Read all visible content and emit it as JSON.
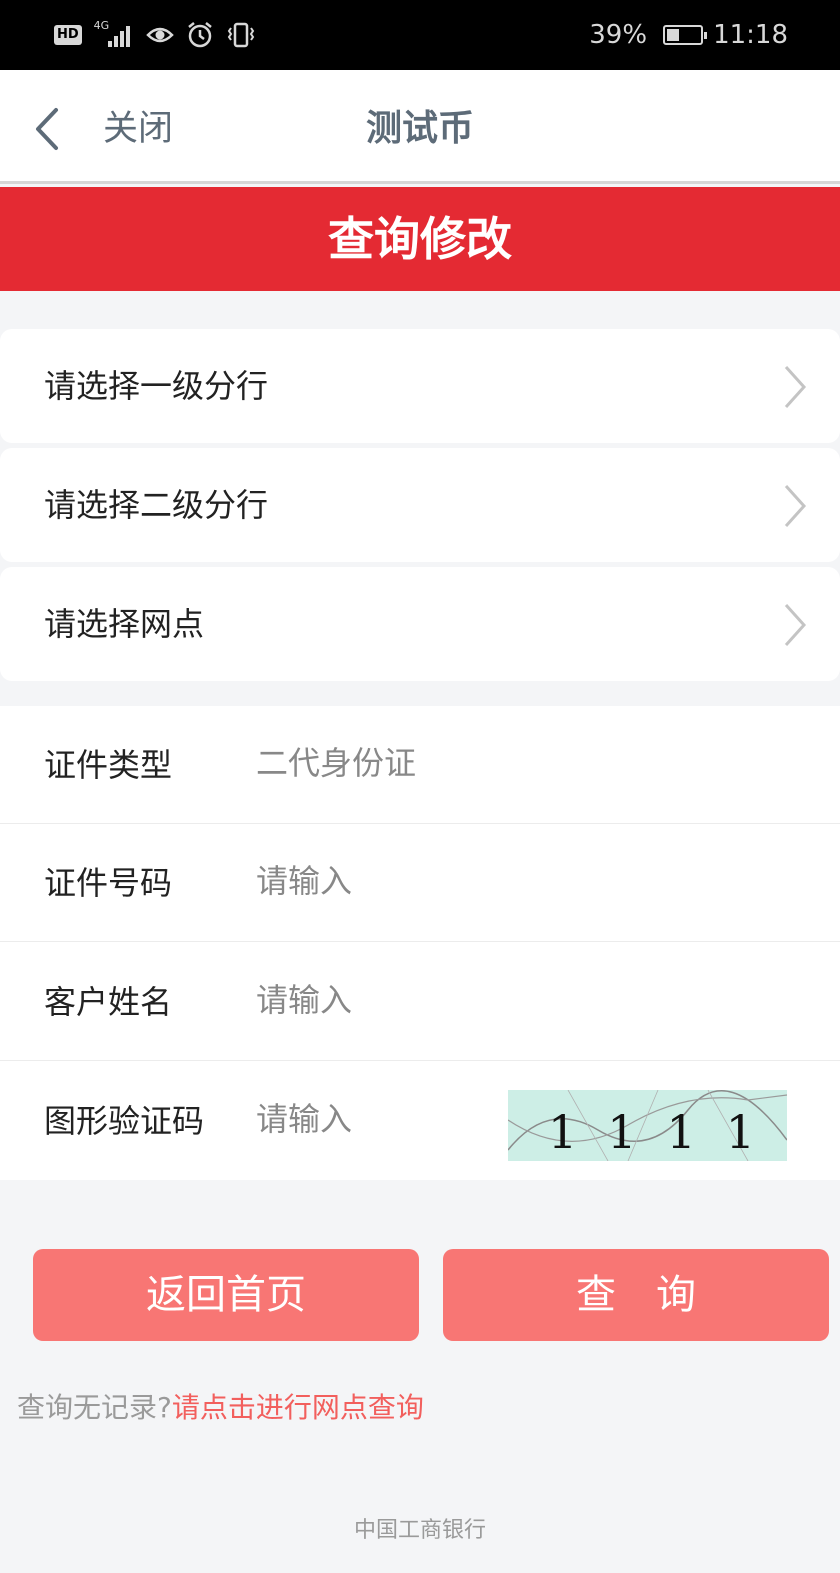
{
  "status_bar": {
    "hd_badge": "HD",
    "network": "4G",
    "icons": [
      "hd-icon",
      "signal-icon",
      "eye-icon",
      "alarm-icon",
      "vibrate-icon"
    ],
    "battery_percent": "39%",
    "battery_level": 0.39,
    "time": "11:18"
  },
  "nav": {
    "close_label": "关闭",
    "title": "测试币"
  },
  "page_header": "查询修改",
  "branch_selectors": [
    {
      "label": "请选择一级分行"
    },
    {
      "label": "请选择二级分行"
    },
    {
      "label": "请选择网点"
    }
  ],
  "form": {
    "id_type": {
      "label": "证件类型",
      "value": "二代身份证"
    },
    "id_number": {
      "label": "证件号码",
      "placeholder": "请输入"
    },
    "customer_name": {
      "label": "客户姓名",
      "placeholder": "请输入"
    },
    "captcha": {
      "label": "图形验证码",
      "placeholder": "请输入",
      "image_text": "1111"
    }
  },
  "buttons": {
    "home": "返回首页",
    "query": "查询"
  },
  "hint": {
    "static": "查询无记录?",
    "link": "请点击进行网点查询"
  },
  "footer": "中国工商银行",
  "colors": {
    "header_red": "#e42a33",
    "button_red": "#f87674",
    "link_red": "#f25f5d"
  }
}
